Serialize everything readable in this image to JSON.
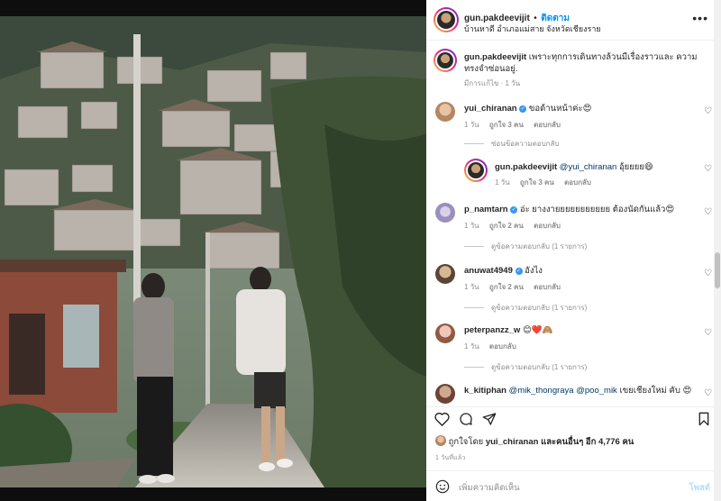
{
  "header": {
    "username": "gun.pakdeevijit",
    "separator": "•",
    "follow_label": "ติดตาม",
    "location": "บ้านหาดี อำเภอแม่สาย จังหวัดเชียงราย",
    "more_label": "•••"
  },
  "caption": {
    "username": "gun.pakdeevijit",
    "text": "เพราะทุกการเดินทางล้วนมีเรื่องราวและ ความทรงจำซ่อนอยู่.",
    "meta": "มีการแก้ไข · 1 วัน"
  },
  "comments": [
    {
      "username": "yui_chiranan",
      "verified": true,
      "text": "ขอด้านหน้าค่ะ😍",
      "time": "1 วัน",
      "likes": "ถูกใจ 3 คน",
      "reply_label": "ตอบกลับ",
      "replies_toggle": "ซ่อนข้อความตอบกลับ"
    },
    {
      "username": "gun.pakdeevijit",
      "mention": "@yui_chiranan",
      "text": "อุ้ยยยย😄",
      "time": "1 วัน",
      "likes": "ถูกใจ 3 คน",
      "reply_label": "ตอบกลับ"
    },
    {
      "username": "p_namtarn",
      "verified": true,
      "text": "อ่ะ ยางงายยยยยยยยยยย ต้องนัดกันแล้ว😍",
      "time": "1 วัน",
      "likes": "ถูกใจ 2 คน",
      "reply_label": "ตอบกลับ",
      "replies_toggle": "ดูข้อความตอบกลับ (1 รายการ)"
    },
    {
      "username": "anuwat4949",
      "verified": true,
      "text": "อังไง",
      "time": "1 วัน",
      "likes": "ถูกใจ 2 คน",
      "reply_label": "ตอบกลับ",
      "replies_toggle": "ดูข้อความตอบกลับ (1 รายการ)"
    },
    {
      "username": "peterpanzz_w",
      "text": "😊❤️🙈",
      "time": "1 วัน",
      "reply_label": "ตอบกลับ",
      "replies_toggle": "ดูข้อความตอบกลับ (1 รายการ)"
    },
    {
      "username": "k_kitiphan",
      "mention1": "@mik_thongraya",
      "mention2": "@poo_mik",
      "text": "เขยเชียงใหม่ คับ 😍"
    }
  ],
  "likes": {
    "prefix": "ถูกใจโดย",
    "user": "yui_chiranan",
    "suffix": "และคนอื่นๆ อีก 4,776 คน"
  },
  "timestamp": "1 วันที่แล้ว",
  "add_comment": {
    "placeholder": "เพิ่มความคิดเห็น",
    "post_label": "โพสต์"
  },
  "icons": {
    "heart": "heart-icon",
    "comment": "comment-icon",
    "share": "share-icon",
    "save": "bookmark-icon",
    "emoji": "emoji-icon"
  },
  "colors": {
    "accent": "#0095f6",
    "verified": "#3897f0",
    "muted": "#8e8e8e",
    "text": "#262626"
  }
}
